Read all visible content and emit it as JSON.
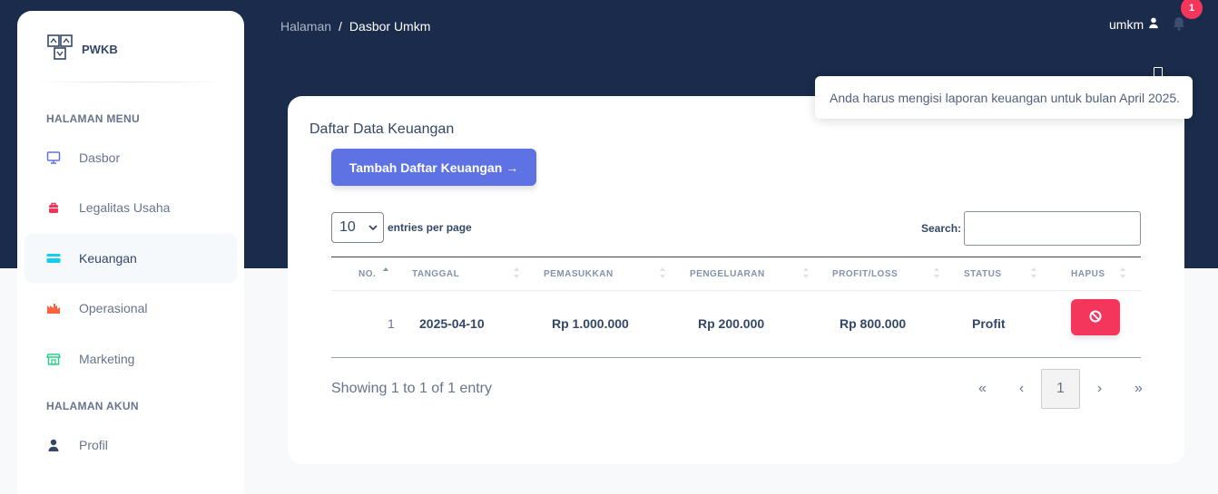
{
  "brand": {
    "name": "PWKB"
  },
  "sidebar": {
    "section_menu": "HALAMAN MENU",
    "section_account": "HALAMAN AKUN",
    "items": [
      {
        "label": "Dasbor",
        "icon": "monitor-icon",
        "color": "#5e72e4"
      },
      {
        "label": "Legalitas Usaha",
        "icon": "briefcase-icon",
        "color": "#f5365c"
      },
      {
        "label": "Keuangan",
        "icon": "credit-card-icon",
        "color": "#11cdef",
        "active": true
      },
      {
        "label": "Operasional",
        "icon": "factory-icon",
        "color": "#fb6340"
      },
      {
        "label": "Marketing",
        "icon": "shop-icon",
        "color": "#2dce89"
      }
    ],
    "account_items": [
      {
        "label": "Profil",
        "icon": "user-icon",
        "color": "#344767"
      }
    ]
  },
  "header": {
    "breadcrumb_root": "Halaman",
    "breadcrumb_sep": "/",
    "breadcrumb_current": "Dasbor Umkm",
    "username": "umkm",
    "notification_count": "1"
  },
  "toast": {
    "message": "Anda harus mengisi laporan keuangan untuk bulan April 2025."
  },
  "card": {
    "title": "Daftar Data Keuangan",
    "add_button": "Tambah Daftar Keuangan",
    "add_button_arrow": "→",
    "per_page_value": "10",
    "per_page_label": "entries per page",
    "search_label": "Search:",
    "search_value": "",
    "columns": [
      "NO.",
      "TANGGAL",
      "PEMASUKKAN",
      "PENGELUARAN",
      "PROFIT/LOSS",
      "STATUS",
      "HAPUS"
    ],
    "rows": [
      {
        "no": "1",
        "tanggal": "2025-04-10",
        "pemasukkan": "Rp 1.000.000",
        "pengeluaran": "Rp 200.000",
        "profit_loss": "Rp 800.000",
        "status": "Profit"
      }
    ],
    "info": "Showing 1 to 1 of 1 entry",
    "pagination": {
      "first": "«",
      "prev": "‹",
      "current": "1",
      "next": "›",
      "last": "»"
    }
  },
  "colors": {
    "primary": "#5e72e4",
    "danger": "#f5365c",
    "header_bg": "#1a2b4b"
  }
}
